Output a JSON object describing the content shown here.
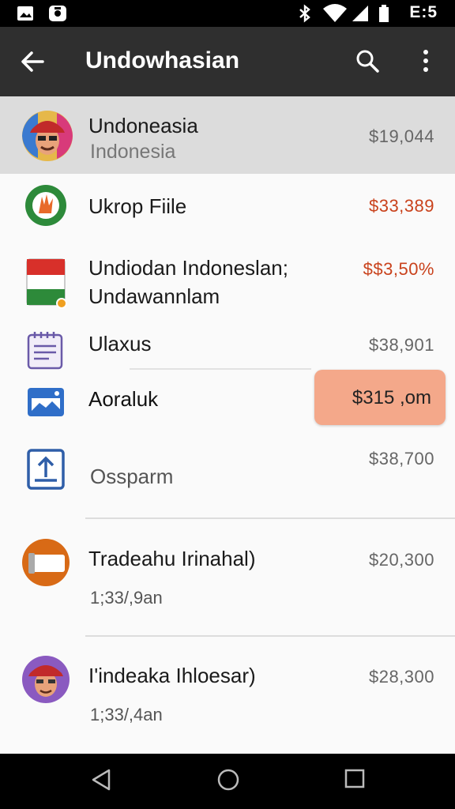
{
  "status_bar": {
    "time": "E:5",
    "icons": [
      "gallery-icon",
      "camera-notification-icon",
      "bluetooth-icon",
      "wifi-icon",
      "signal-icon",
      "battery-icon"
    ]
  },
  "app_bar": {
    "title": "Undowhasian",
    "icons": [
      "back-arrow-icon",
      "search-icon",
      "more-vert-icon"
    ]
  },
  "list": {
    "items": [
      {
        "name": "Undoneasia",
        "subtitle": "Indonesia",
        "amount": "$19,044",
        "icon": "avatar-cap",
        "selected": true
      },
      {
        "name": "Ukrop Fiile",
        "amount": "$33,389",
        "icon": "food-circle-icon",
        "amount_color": "#c9421c"
      },
      {
        "name": "Undiodan Indoneslan;",
        "name_line2": "Undawannlam",
        "amount": "$$3,50%",
        "icon": "flag-icon",
        "amount_color": "#c9421c"
      },
      {
        "name": "Ulaxus",
        "amount": "$38,901",
        "icon": "notepad-icon"
      },
      {
        "name": "Aoraluk",
        "amount": "$315 ,om",
        "icon": "image-card-icon",
        "highlighted": true
      },
      {
        "subtitle": "Ossparm",
        "amount": "$38,700",
        "icon": "upload-box-icon"
      },
      {
        "name": "Tradeahu Irinahal)",
        "subtitle": "1;33/,9an",
        "amount": "$20,300",
        "icon": "orange-card-icon"
      },
      {
        "name": "I'indeaka Ihloesar)",
        "subtitle": "1;33/,4an",
        "amount": "$28,300",
        "icon": "avatar-cap-2"
      }
    ]
  },
  "colors": {
    "app_bar": "#2f2f2f",
    "selected_row": "#dcdcdc",
    "accent_red": "#c9421c",
    "highlight_pill": "#f4a88a"
  },
  "nav_bar": {
    "icons": [
      "back-triangle-icon",
      "home-circle-icon",
      "recents-square-icon"
    ]
  }
}
